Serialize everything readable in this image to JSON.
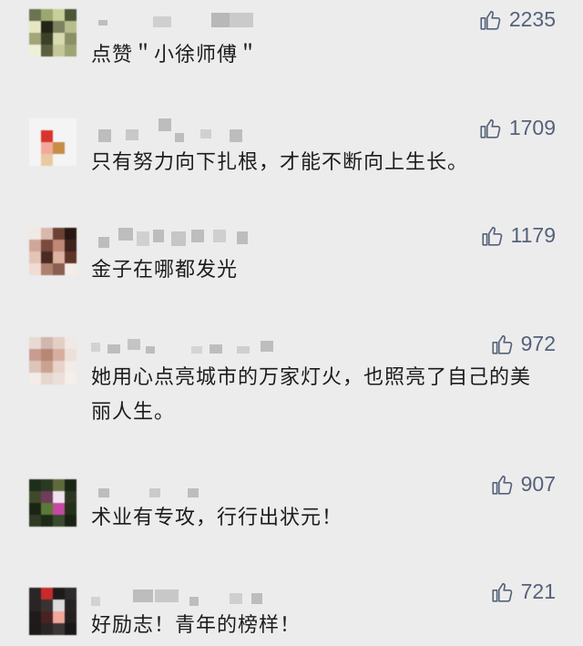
{
  "comments": [
    {
      "text": "点赞＂小徐师傅＂",
      "likes": "2235",
      "avatar_colors": [
        "#6b7350",
        "#9aa870",
        "#c9cf9c",
        "#4c5536",
        "#e6e7c2",
        "#222418",
        "#7c8160",
        "#b7bd8c",
        "#a3a679",
        "#3c4028",
        "#d8dbb0",
        "#8a8f66",
        "#eef0d8",
        "#5a5f40",
        "#c4c79a",
        "#9ea474"
      ]
    },
    {
      "text": "只有努力向下扎根，才能不断向上生长。",
      "likes": "1709",
      "avatar_colors": [
        "#f4f4f4",
        "#f4f4f4",
        "#f4f4f4",
        "#f4f4f4",
        "#f4f4f4",
        "#d8342e",
        "#f4f4f4",
        "#f4f4f4",
        "#f4f4f4",
        "#f2a99b",
        "#c58d48",
        "#f4f4f4",
        "#f4f4f4",
        "#e9c9a2",
        "#f4f4f4",
        "#f4f4f4"
      ]
    },
    {
      "text": "金子在哪都发光",
      "likes": "1179",
      "avatar_colors": [
        "#f1e9e3",
        "#d7b8ad",
        "#6b4135",
        "#2a1612",
        "#cfa79a",
        "#7b4a3c",
        "#c08876",
        "#3d241d",
        "#e3c5b8",
        "#4a2a22",
        "#dcb2a0",
        "#5e3428",
        "#efdcd2",
        "#b0806f",
        "#8a5e50",
        "#f4ece6"
      ]
    },
    {
      "text": "她用心点亮城市的万家灯火，也照亮了自己的美丽人生。",
      "likes": "972",
      "avatar_colors": [
        "#e7dad3",
        "#d1b7ad",
        "#e3cfc5",
        "#f0e8e2",
        "#c99c90",
        "#b98575",
        "#d5aea0",
        "#ece0d9",
        "#dcc4ba",
        "#c9a292",
        "#e7d3c9",
        "#f2ebe6",
        "#f3ece8",
        "#e5d6cf",
        "#eadfd9",
        "#f5efeb"
      ]
    },
    {
      "text": "术业有专攻，行行出状元！",
      "likes": "907",
      "avatar_colors": [
        "#1f2d1d",
        "#2a3a22",
        "#5e6a3c",
        "#1b2616",
        "#3e4a2a",
        "#6d3d5a",
        "#efe3f0",
        "#2c3522",
        "#1a2414",
        "#5b7a3a",
        "#c34aa0",
        "#243019",
        "#2e3a24",
        "#1e2a18",
        "#3a4a2c",
        "#1a2214"
      ]
    },
    {
      "text": "好励志！青年的榜样！",
      "likes": "721",
      "avatar_colors": [
        "#2b2626",
        "#c72a2a",
        "#1d1a1a",
        "#2c2a2a",
        "#2a2424",
        "#3a3232",
        "#dcdcdc",
        "#262222",
        "#1f1b1b",
        "#4a2222",
        "#f0a89c",
        "#242020",
        "#1d1a1a",
        "#2a2626",
        "#3c3636",
        "#1a1717"
      ]
    }
  ]
}
